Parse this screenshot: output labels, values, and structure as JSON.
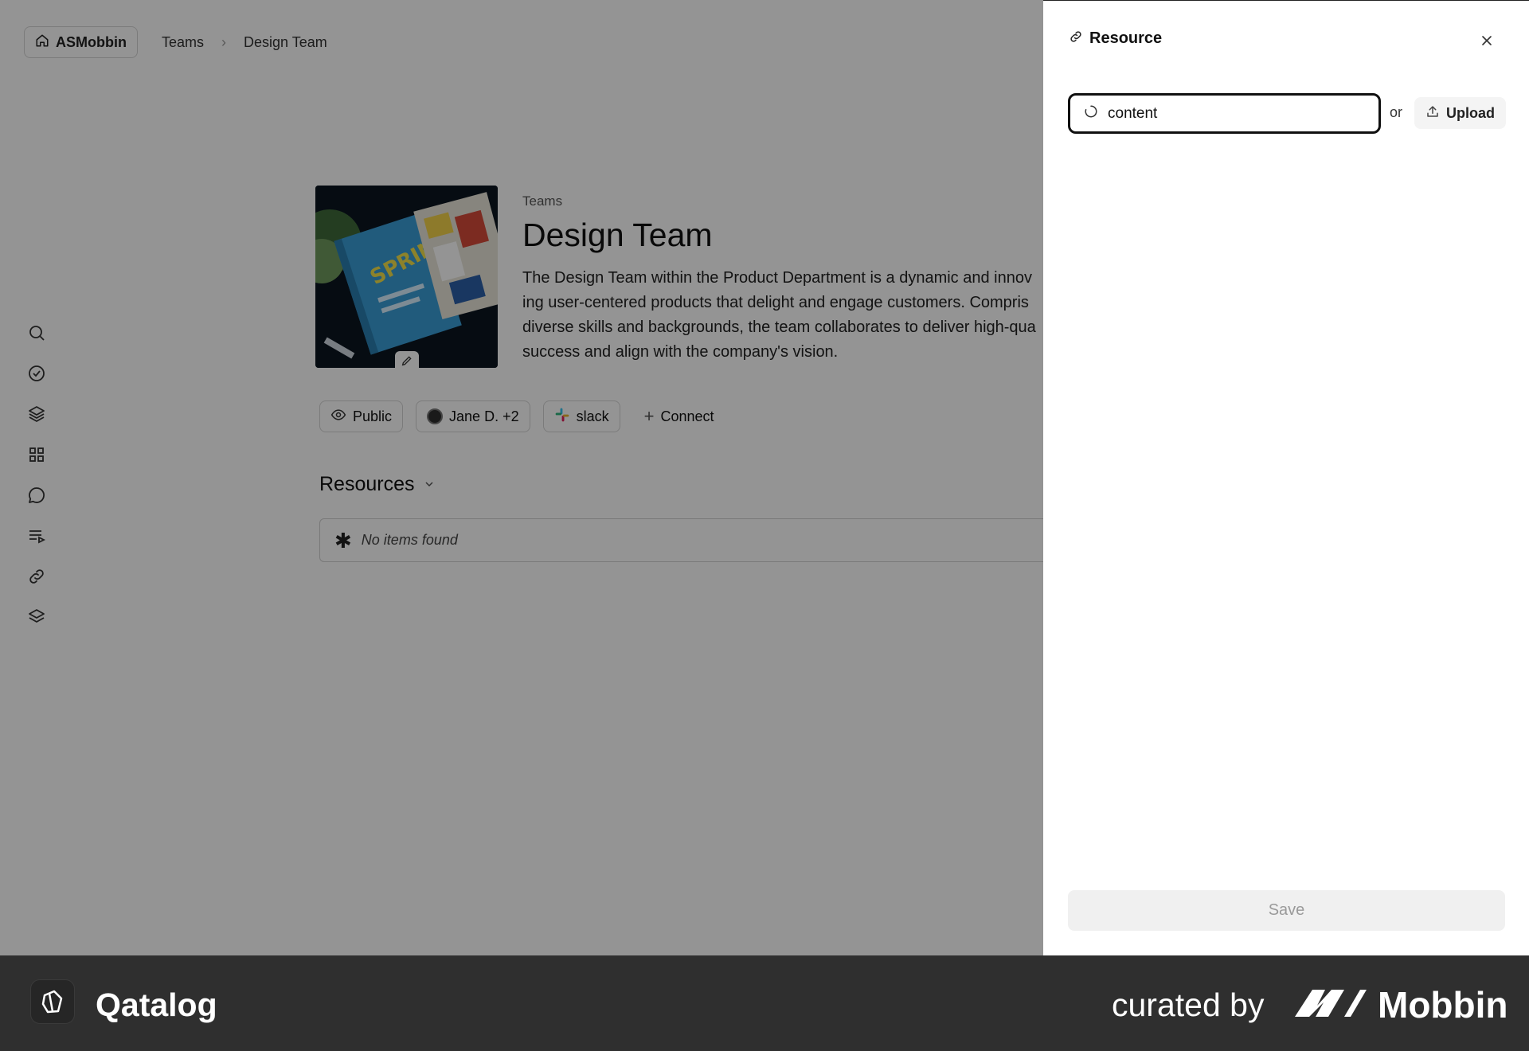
{
  "topbar": {
    "home_label": "ASMobbin",
    "breadcrumb": [
      "Teams",
      "Design Team"
    ]
  },
  "team": {
    "eyebrow": "Teams",
    "title": "Design Team",
    "description_lines": [
      "The Design Team within the Product Department is a dynamic and innov",
      "ing user-centered products that delight and engage customers. Compris",
      "diverse skills and backgrounds, the team collaborates to deliver high-qua",
      "success and align with the company's vision."
    ],
    "chips": {
      "visibility": "Public",
      "members": "Jane D. +2",
      "integration": "slack",
      "connect": "Connect"
    }
  },
  "resources": {
    "heading": "Resources",
    "empty_text": "No items found"
  },
  "panel": {
    "title": "Resource",
    "search_value": "content",
    "or_label": "or",
    "upload_label": "Upload",
    "save_label": "Save"
  },
  "footer": {
    "brand": "Qatalog",
    "curated_by": "curated by",
    "curator": "Mobbin"
  },
  "icons": {
    "home": "home-icon",
    "rail": [
      "search-icon",
      "check-circle-icon",
      "layers-icon",
      "grid-icon",
      "chat-icon",
      "playlist-icon",
      "link-icon",
      "stack-icon"
    ],
    "close": "close-icon",
    "spinner": "spinner-icon",
    "upload": "upload-icon"
  }
}
